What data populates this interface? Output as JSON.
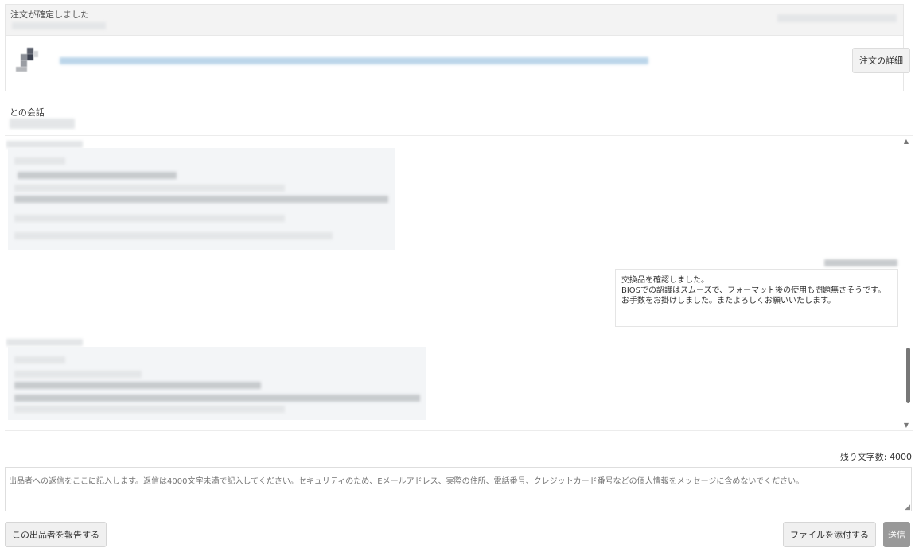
{
  "order": {
    "status_title": "注文が確定しました",
    "detail_button": "注文の詳細"
  },
  "conversation": {
    "label": "との会話"
  },
  "messages": {
    "mine": {
      "lines": [
        "交換品を確認しました。",
        "BIOSでの認識はスムーズで、フォーマット後の使用も問題無さそうです。",
        "お手数をお掛けしました。またよろしくお願いいたします。"
      ]
    }
  },
  "reply": {
    "remaining_label": "残り文字数: 4000",
    "placeholder": "出品者への返信をここに記入します。返信は4000文字未満で記入してください。セキュリティのため、Eメールアドレス、実際の住所、電話番号、クレジットカード番号などの個人情報をメッセージに含めないでください。"
  },
  "actions": {
    "report": "この出品者を報告する",
    "attach": "ファイルを添付する",
    "send": "送信"
  },
  "icons": {
    "scroll_up": "▲",
    "scroll_down": "▼",
    "resize": "◢"
  }
}
